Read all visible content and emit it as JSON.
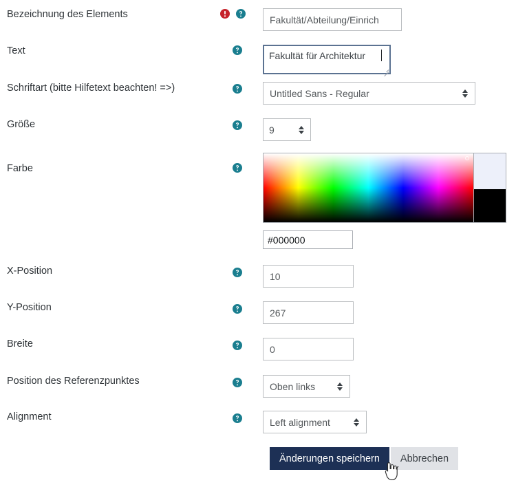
{
  "form": {
    "rows": [
      {
        "id": "bezeichnung",
        "label": "Bezeichnung des Elements",
        "has_error_icon": true,
        "help_icon": "help-circle-icon",
        "error_icon": "error-exclamation-icon",
        "field_type": "text",
        "value": "Fakultät/Abteilung/Einrich"
      },
      {
        "id": "text",
        "label": "Text",
        "has_error_icon": false,
        "help_icon": "help-circle-icon",
        "field_type": "textarea",
        "value": "Fakultät für Architektur",
        "focused": true
      },
      {
        "id": "schriftart",
        "label": "Schriftart (bitte Hilfetext beachten! =>)",
        "has_error_icon": false,
        "help_icon": "help-circle-icon",
        "field_type": "select",
        "value": "Untitled Sans - Regular"
      },
      {
        "id": "groesse",
        "label": "Größe",
        "has_error_icon": false,
        "help_icon": "help-circle-icon",
        "field_type": "number",
        "value": "9"
      },
      {
        "id": "farbe",
        "label": "Farbe",
        "has_error_icon": false,
        "help_icon": "help-circle-icon",
        "field_type": "color",
        "value": "#000000"
      },
      {
        "id": "x-position",
        "label": "X-Position",
        "has_error_icon": false,
        "help_icon": "help-circle-icon",
        "field_type": "text",
        "value": "10"
      },
      {
        "id": "y-position",
        "label": "Y-Position",
        "has_error_icon": false,
        "help_icon": "help-circle-icon",
        "field_type": "text",
        "value": "267"
      },
      {
        "id": "breite",
        "label": "Breite",
        "has_error_icon": false,
        "help_icon": "help-circle-icon",
        "field_type": "text",
        "value": "0"
      },
      {
        "id": "referenzpunkt",
        "label": "Position des Referenzpunktes",
        "has_error_icon": false,
        "help_icon": "help-circle-icon",
        "field_type": "select",
        "value": "Oben links"
      },
      {
        "id": "alignment",
        "label": "Alignment",
        "has_error_icon": false,
        "help_icon": "help-circle-icon",
        "field_type": "select",
        "value": "Left alignment"
      }
    ]
  },
  "color_picker": {
    "hex_value": "#000000",
    "preview_old": "#edf0fa",
    "preview_new": "#000000"
  },
  "buttons": {
    "save_label": "Änderungen speichern",
    "cancel_label": "Abbrechen"
  },
  "colors": {
    "help_icon": "#1a7e8f",
    "error_icon": "#c6222a",
    "primary_button_bg": "#1d3055",
    "secondary_button_bg": "#e0e2e6",
    "focus_border": "#5b7291",
    "input_border": "#b9bcbf"
  },
  "cursor": {
    "type": "pointer-hand-cursor"
  }
}
